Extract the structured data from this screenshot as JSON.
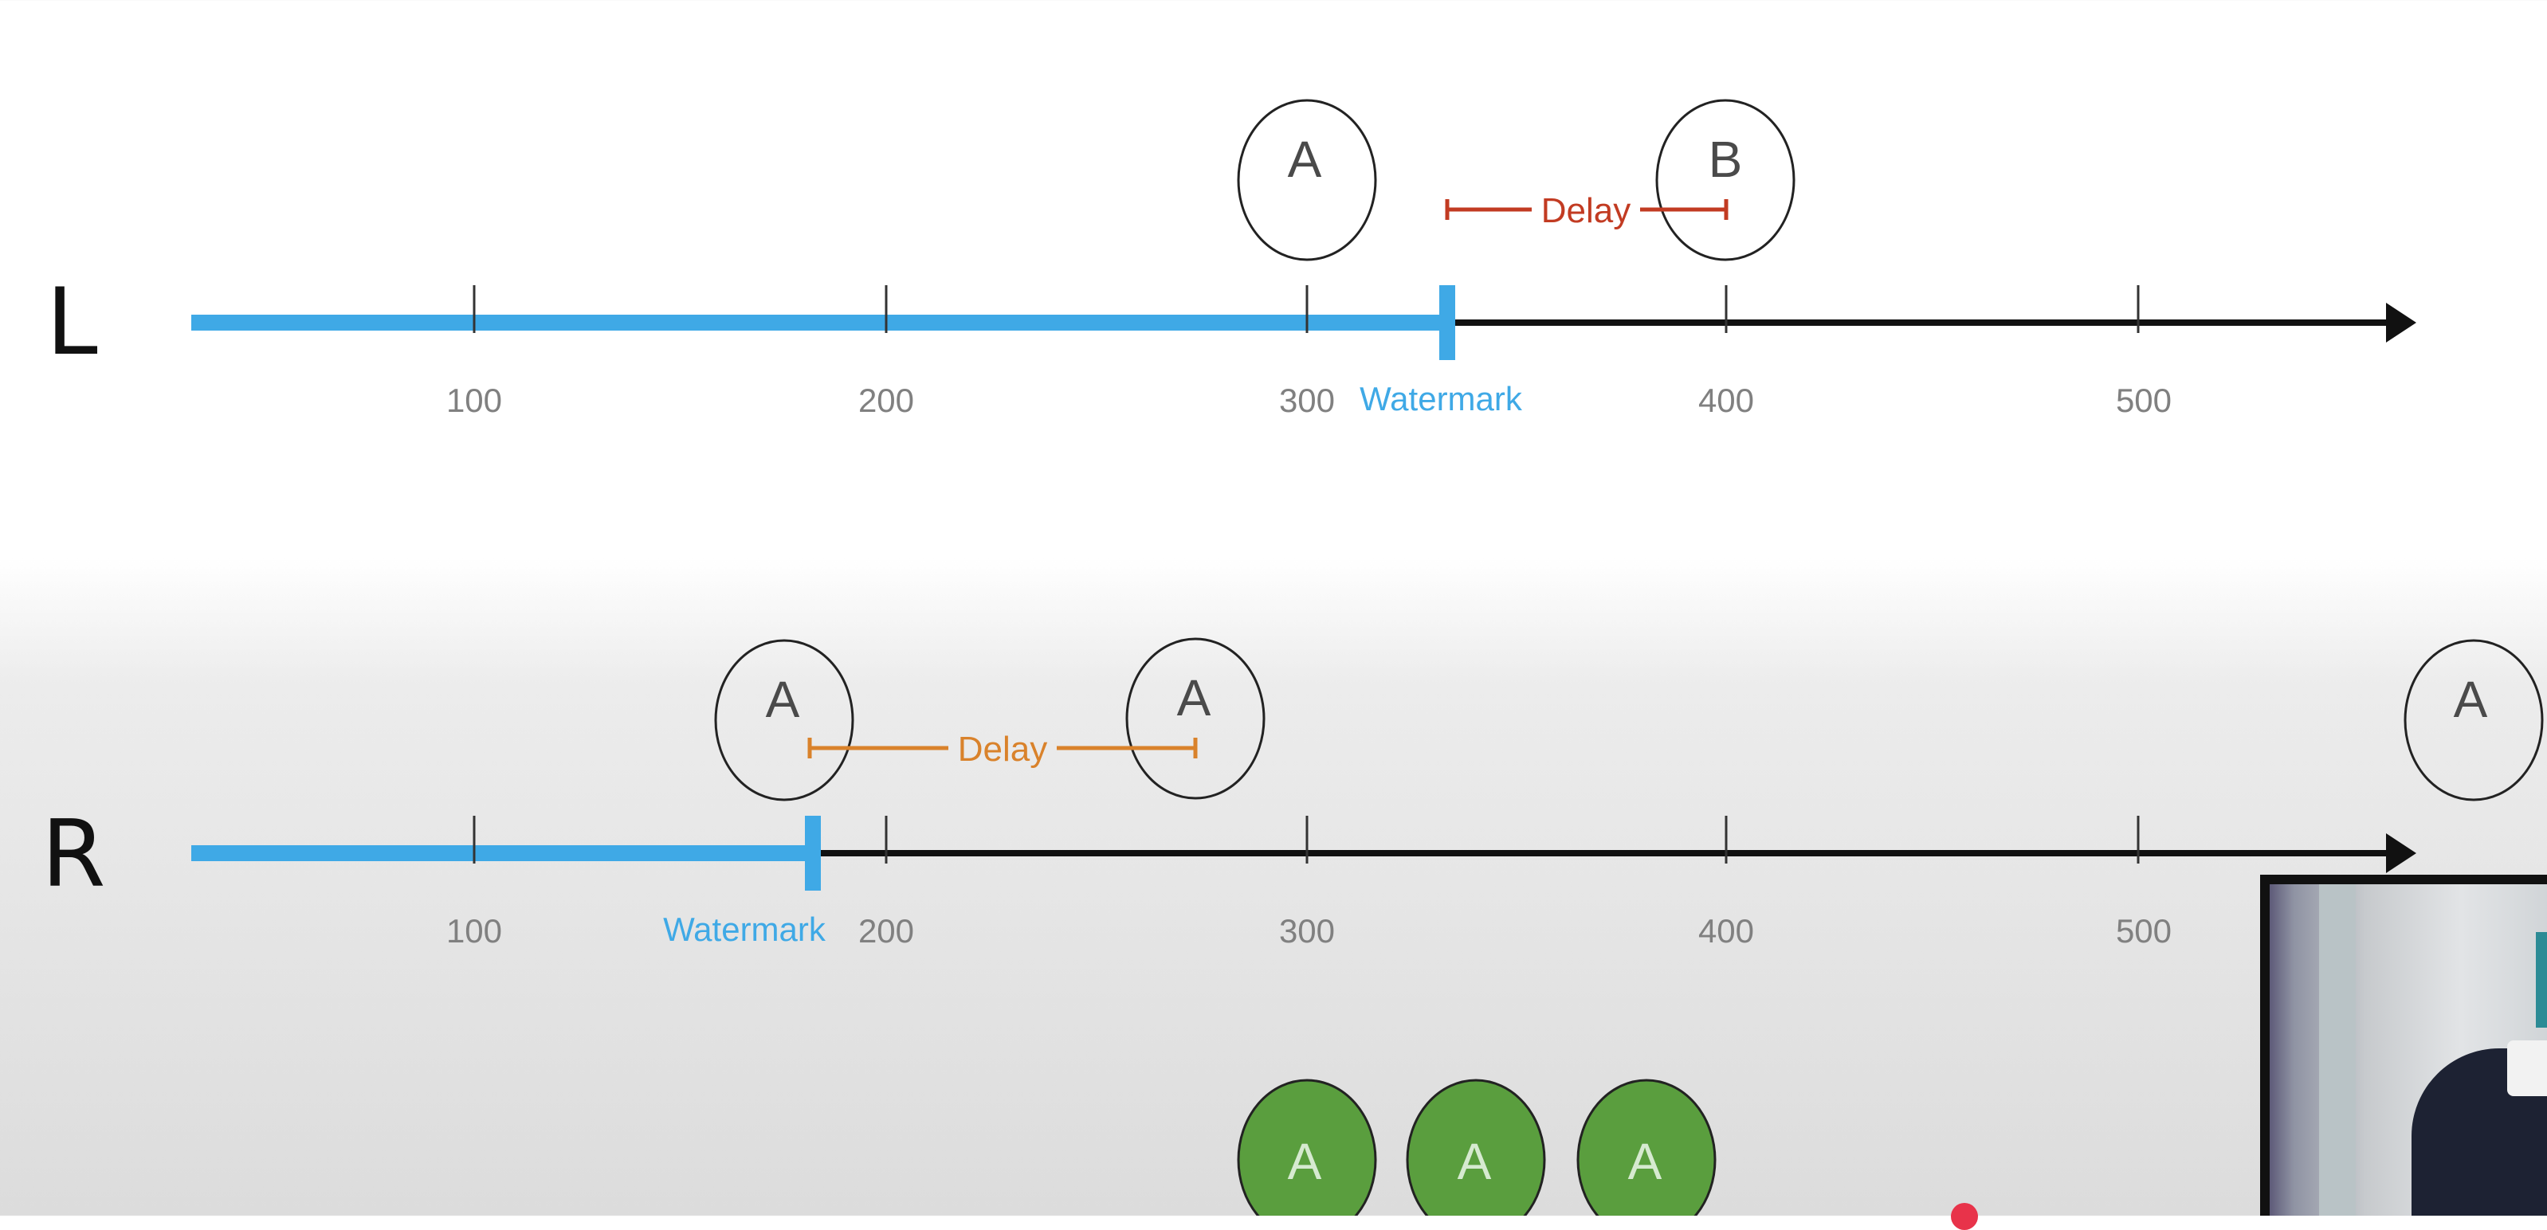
{
  "rows": [
    {
      "label": "L",
      "ticks": [
        "100",
        "200",
        "300",
        "400",
        "500"
      ],
      "watermark_label": "Watermark",
      "watermark_value": 335,
      "delay_label": "Delay",
      "delay_color": "#c23b22",
      "events": [
        "A",
        "B"
      ]
    },
    {
      "label": "R",
      "ticks": [
        "100",
        "200",
        "300",
        "400",
        "500"
      ],
      "watermark_label": "Watermark",
      "watermark_value": 182,
      "delay_label": "Delay",
      "delay_color": "#d9822b",
      "events": [
        "A",
        "A",
        "A"
      ]
    }
  ],
  "output_events": [
    "A",
    "A",
    "A"
  ],
  "colors": {
    "watermark": "#3fa9e6",
    "axis": "#111111",
    "output_event_fill": "#5a9e3e"
  }
}
